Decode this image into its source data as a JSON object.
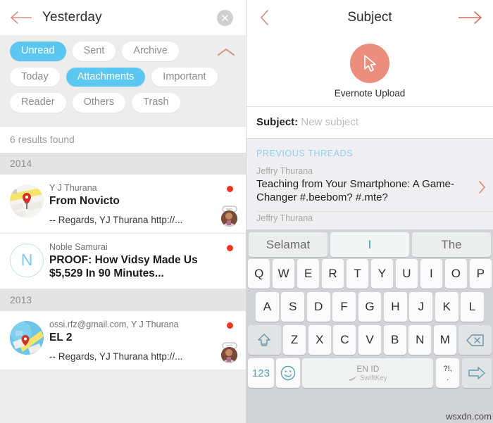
{
  "left": {
    "header": {
      "title": "Yesterday",
      "back_icon": "back-arrow-icon",
      "close_icon": "close-icon"
    },
    "filters": {
      "collapse_icon": "chevron-up-icon",
      "rows": [
        [
          {
            "label": "Unread",
            "active": true
          },
          {
            "label": "Sent",
            "active": false
          },
          {
            "label": "Archive",
            "active": false
          }
        ],
        [
          {
            "label": "Today",
            "active": false
          },
          {
            "label": "Attachments",
            "active": true
          },
          {
            "label": "Important",
            "active": false
          }
        ],
        [
          {
            "label": "Reader",
            "active": false
          },
          {
            "label": "Others",
            "active": false
          },
          {
            "label": "Trash",
            "active": false
          }
        ]
      ]
    },
    "results_text": "6 results found",
    "sections": [
      {
        "year": "2014",
        "messages": [
          {
            "sender": "Y J Thurana",
            "subject": "From Novicto",
            "snippet": "-- Regards, YJ Thurana http://...",
            "avatar_type": "map",
            "unread": true,
            "attachment": true,
            "thumb": true
          },
          {
            "sender": "Noble Samurai",
            "subject": "PROOF: How Vidsy Made Us $5,529 In 90 Minutes...",
            "snippet": "",
            "avatar_type": "letter",
            "avatar_letter": "N",
            "unread": true,
            "attachment": false,
            "thumb": false
          }
        ]
      },
      {
        "year": "2013",
        "messages": [
          {
            "sender": "ossi.rfz@gmail.com, Y J Thurana",
            "subject": "EL 2",
            "snippet": "-- Regards, YJ Thurana http://...",
            "avatar_type": "map-blue",
            "unread": true,
            "attachment": true,
            "thumb": true
          }
        ]
      }
    ]
  },
  "right": {
    "header": {
      "title": "Subject",
      "back_icon": "chevron-left-icon",
      "forward_icon": "forward-arrow-icon"
    },
    "upload": {
      "label": "Evernote Upload",
      "icon": "cursor-arrow-icon",
      "circle_color": "#ec8e7e"
    },
    "subject": {
      "key_label": "Subject:",
      "placeholder": "New subject",
      "value": ""
    },
    "threads_header": "PREVIOUS THREADS",
    "threads": [
      {
        "sender": "Jeffry Thurana",
        "subject": "Teaching from Your Smartphone: A Game-Changer #.beebom? #.mte?",
        "chevron_icon": "chevron-right-icon"
      },
      {
        "sender": "Jeffry Thurana",
        "subject": "",
        "chevron_icon": "chevron-right-icon"
      }
    ]
  },
  "keyboard": {
    "suggestions": [
      "Selamat",
      "I",
      "The"
    ],
    "rows": [
      [
        "Q",
        "W",
        "E",
        "R",
        "T",
        "Y",
        "U",
        "I",
        "O",
        "P"
      ],
      [
        "A",
        "S",
        "D",
        "F",
        "G",
        "H",
        "J",
        "K",
        "L"
      ],
      [
        "Z",
        "X",
        "C",
        "V",
        "B",
        "N",
        "M"
      ]
    ],
    "shift_icon": "shift-up-icon",
    "backspace_icon": "backspace-icon",
    "numbers_key": "123",
    "emoji_icon": "emoji-smiley-icon",
    "space_language": "EN ID",
    "space_brand": "SwiftKey",
    "punctuation_top": "?!,",
    "punctuation_bottom": ".",
    "enter_icon": "enter-arrow-icon"
  },
  "watermark": "wsxdn.com",
  "colors": {
    "accent_blue": "#5cc8f2",
    "accent_coral": "#ec8e7e",
    "unread_dot": "#f4331f",
    "thread_header": "#8fd0ee"
  }
}
